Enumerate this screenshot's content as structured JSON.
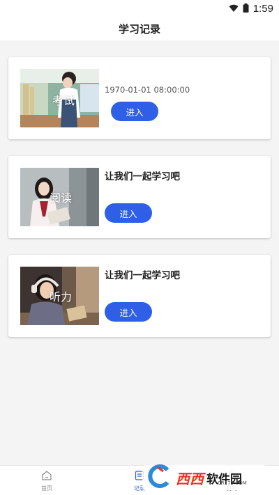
{
  "status_bar": {
    "time": "1:59",
    "icons": [
      "wifi-icon",
      "battery-icon"
    ]
  },
  "header": {
    "title": "学习记录"
  },
  "cards": [
    {
      "thumb_label": "考试",
      "subtitle": "1970-01-01 08:00:00",
      "button_label": "进入"
    },
    {
      "thumb_label": "阅读",
      "heading": "让我们一起学习吧",
      "button_label": "进入"
    },
    {
      "thumb_label": "听力",
      "heading": "让我们一起学习吧",
      "button_label": "进入"
    }
  ],
  "tab_bar": {
    "items": [
      {
        "label": "首页",
        "icon": "home-icon"
      },
      {
        "label": "记录",
        "icon": "records-icon"
      },
      {
        "label": "我的",
        "icon": "user-icon"
      }
    ],
    "active_color": "#2f5fe6"
  },
  "watermark": {
    "brand": "西西",
    "name": "软件园",
    "domain": "CR173.COM"
  },
  "colors": {
    "accent": "#2f5fe6",
    "background": "#f4f4f4"
  }
}
